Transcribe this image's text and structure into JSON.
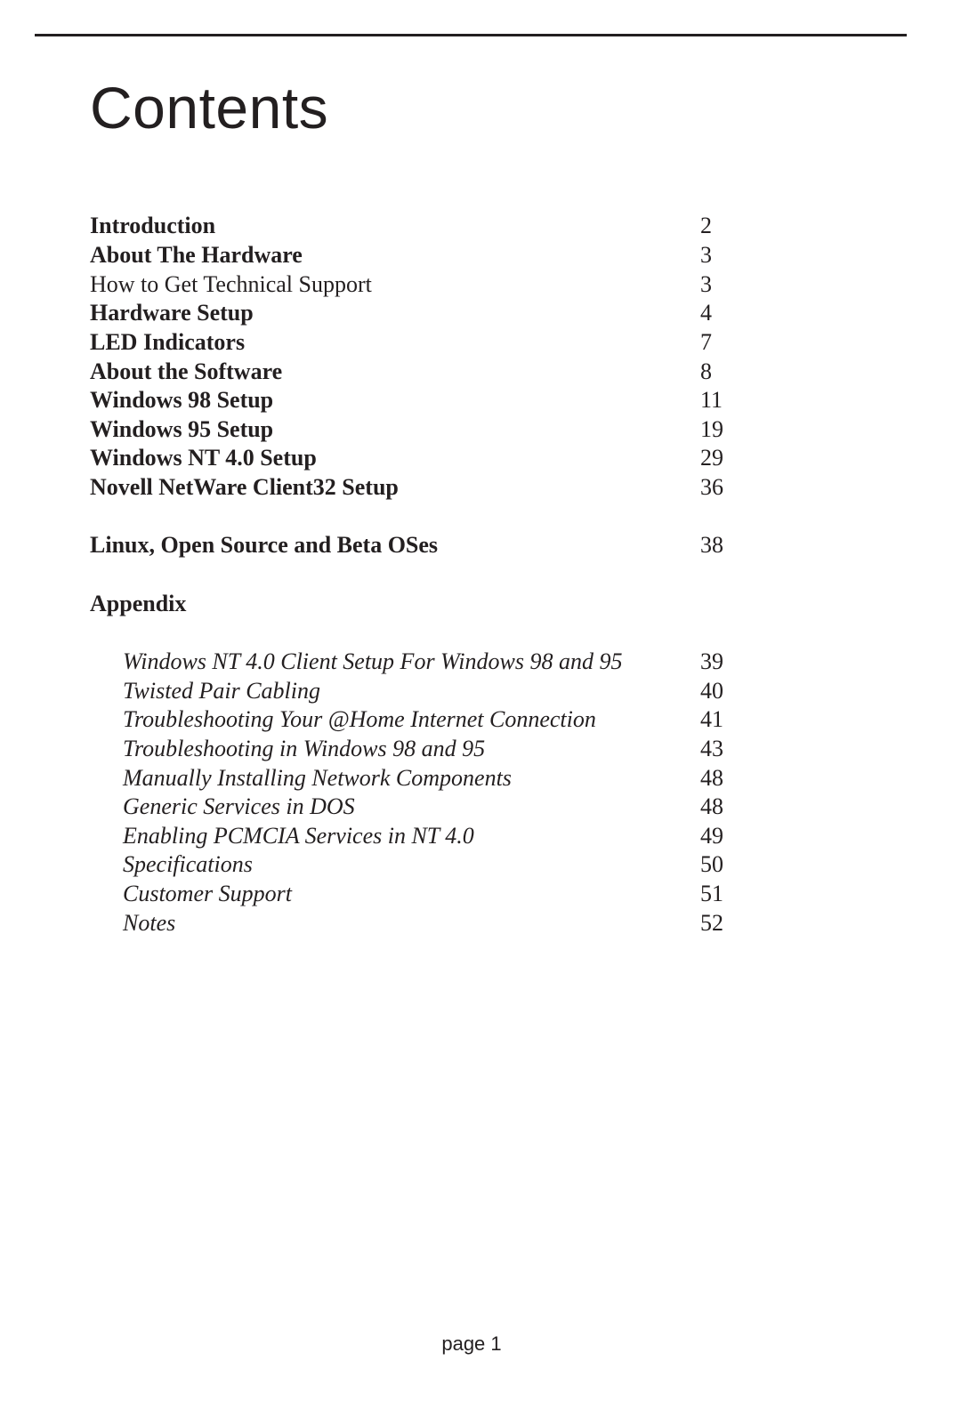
{
  "page": {
    "title": "Contents",
    "footer": "page 1"
  },
  "toc": {
    "main": [
      {
        "label": "Introduction",
        "page": "2",
        "style": "bold"
      },
      {
        "label": "About The Hardware",
        "page": "3",
        "style": "bold"
      },
      {
        "label": "How to Get Technical Support",
        "page": "3",
        "style": "regular"
      },
      {
        "label": "Hardware Setup",
        "page": "4",
        "style": "bold"
      },
      {
        "label": "LED Indicators",
        "page": "7",
        "style": "bold"
      },
      {
        "label": "About the Software",
        "page": "8",
        "style": "bold"
      },
      {
        "label": "Windows 98 Setup",
        "page": "11",
        "style": "bold"
      },
      {
        "label": "Windows 95 Setup",
        "page": "19",
        "style": "bold"
      },
      {
        "label": "Windows NT 4.0 Setup",
        "page": "29",
        "style": "bold"
      },
      {
        "label": "Novell NetWare Client32 Setup",
        "page": "36",
        "style": "bold"
      }
    ],
    "linux": {
      "label": "Linux, Open Source and Beta OSes",
      "page": "38"
    },
    "appendix_heading": "Appendix",
    "appendix": [
      {
        "label": "Windows NT 4.0 Client Setup For Windows 98 and 95",
        "page": "39"
      },
      {
        "label": "Twisted Pair Cabling",
        "page": "40"
      },
      {
        "label": "Troubleshooting Your @Home Internet Connection",
        "page": "41"
      },
      {
        "label": "Troubleshooting in Windows 98 and 95",
        "page": "43"
      },
      {
        "label": "Manually Installing Network Components",
        "page": "48"
      },
      {
        "label": "Generic Services in DOS",
        "page": "48"
      },
      {
        "label": "Enabling PCMCIA Services in NT 4.0",
        "page": "49"
      },
      {
        "label": "Specifications",
        "page": "50"
      },
      {
        "label": "Customer Support",
        "page": "51"
      },
      {
        "label": "Notes",
        "page": "52"
      }
    ]
  }
}
